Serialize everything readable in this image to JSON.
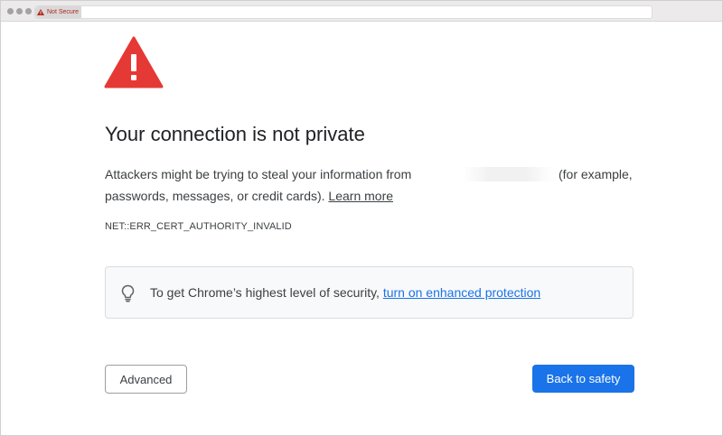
{
  "browser": {
    "security_chip": {
      "label": "Not Secure",
      "icon": "warning-triangle-icon",
      "color": "#b3261e"
    }
  },
  "page": {
    "icon": "warning-triangle-icon",
    "icon_color": "#e53935",
    "title": "Your connection is not private",
    "body_line1": "Attackers might be trying to steal your information from",
    "body_example": "(for example,",
    "body_line2": "passwords, messages, or credit cards).",
    "learn_more": "Learn more",
    "error_code": "NET::ERR_CERT_AUTHORITY_INVALID",
    "promo": {
      "icon": "lightbulb-icon",
      "text": "To get Chrome’s highest level of security,",
      "link": "turn on enhanced protection"
    },
    "buttons": {
      "advanced": "Advanced",
      "back_to_safety": "Back to safety"
    },
    "accent_color": "#1a73e8"
  }
}
